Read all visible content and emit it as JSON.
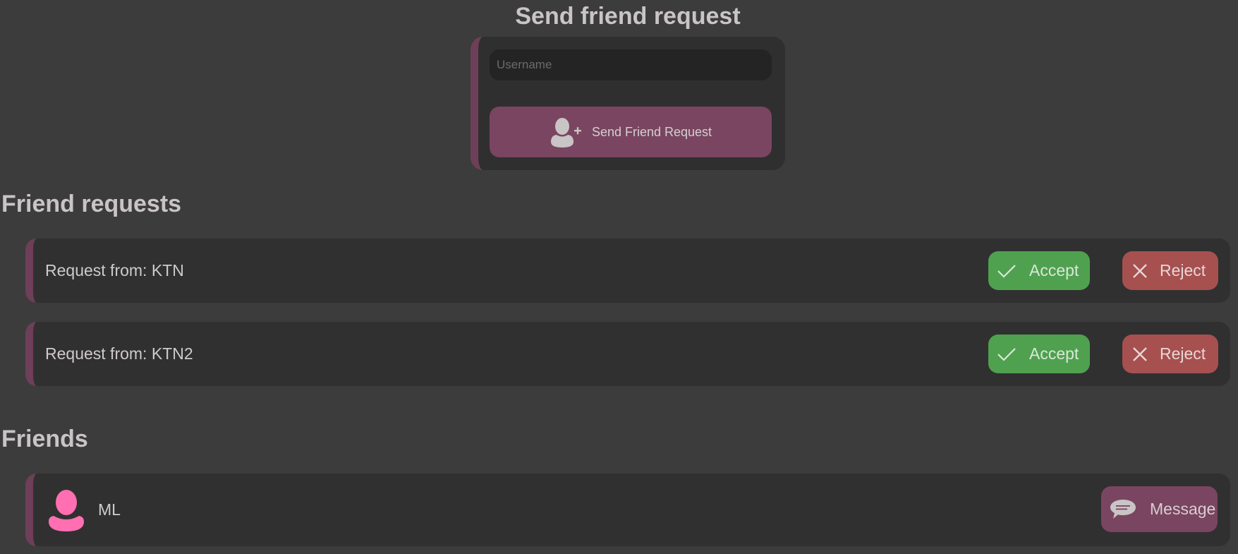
{
  "send_request": {
    "title": "Send friend request",
    "username_value": "",
    "username_placeholder": "Username",
    "button_label": "Send Friend Request",
    "button_icon": "add-user-icon"
  },
  "friend_requests": {
    "title": "Friend requests",
    "items": [
      {
        "text": "Request from: KTN",
        "accept_label": "Accept",
        "reject_label": "Reject"
      },
      {
        "text": "Request from: KTN2",
        "accept_label": "Accept",
        "reject_label": "Reject"
      }
    ]
  },
  "friends": {
    "title": "Friends",
    "items": [
      {
        "name": "ML",
        "avatar_icon": "user-avatar-icon",
        "message_label": "Message",
        "message_icon": "chat-bubble-icon"
      }
    ]
  },
  "colors": {
    "background": "#3c3c3c",
    "panel": "#303030",
    "accent": "#7a4560",
    "accent_border": "#6e3f58",
    "accept": "#4fa14f",
    "reject": "#a65050",
    "avatar": "#ff6fb2",
    "text": "#c9c4c6"
  }
}
